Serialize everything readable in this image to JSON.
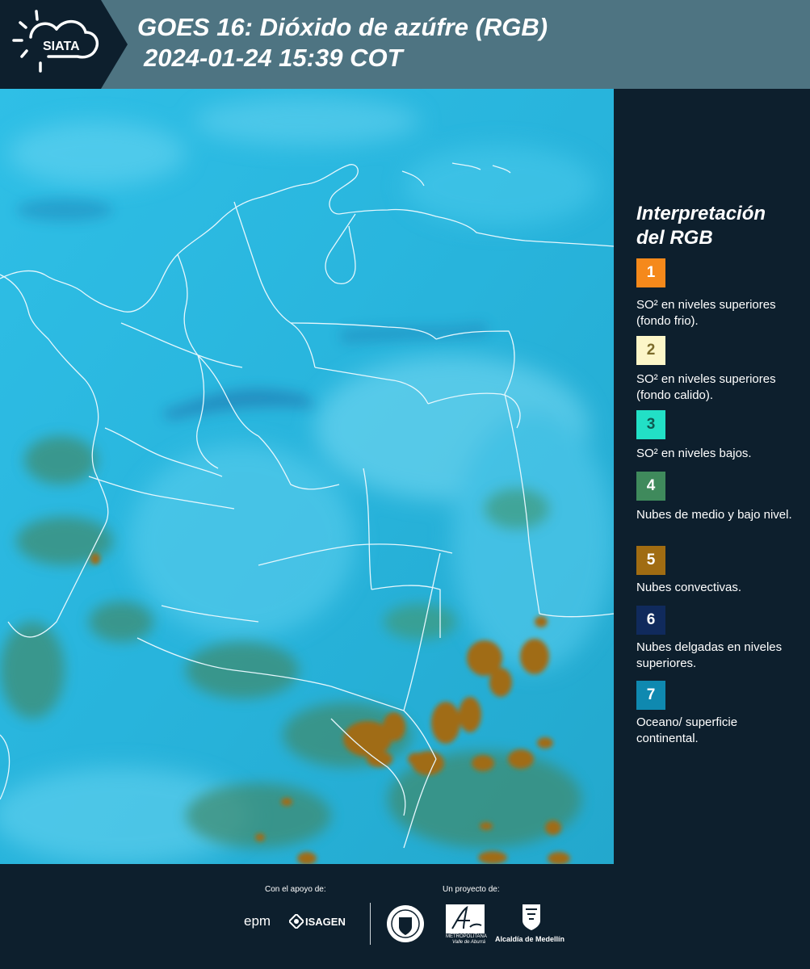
{
  "header": {
    "logo_text": "SIATA",
    "title_line1": "GOES 16: Dióxido de azúfre (RGB)",
    "title_line2": "2024-01-24 15:39 COT"
  },
  "legend": {
    "title": "Interpretación del RGB",
    "items": [
      {
        "number": "1",
        "color": "#f5891b",
        "label": "SO² en niveles superiores (fondo frio)."
      },
      {
        "number": "2",
        "color": "#fcf6c8",
        "label": "SO² en niveles superiores (fondo calido)."
      },
      {
        "number": "3",
        "color": "#22e0c6",
        "label": "SO² en niveles bajos."
      },
      {
        "number": "4",
        "color": "#3f8a5c",
        "label": "Nubes de medio y bajo nivel."
      },
      {
        "number": "5",
        "color": "#a06c12",
        "label": "Nubes convectivas."
      },
      {
        "number": "6",
        "color": "#102a5c",
        "label": "Nubes delgadas en niveles superiores."
      },
      {
        "number": "7",
        "color": "#0f89b0",
        "label": "Oceano/ superficie continental."
      }
    ]
  },
  "footer": {
    "support_label": "Con el apoyo de:",
    "project_label": "Un proyecto de:",
    "epm": "epm",
    "isagen": "ISAGEN",
    "area_metro": "METROPOLITANA",
    "area_metro_sub": "Valle de Aburrá",
    "alcaldia": "Alcaldía de Medellín"
  },
  "icons": [
    "sun-cloud-logo-icon",
    "isagen-logo-icon",
    "univ-seal-icon",
    "area-metropolitana-logo-icon",
    "alcaldia-shield-icon"
  ]
}
